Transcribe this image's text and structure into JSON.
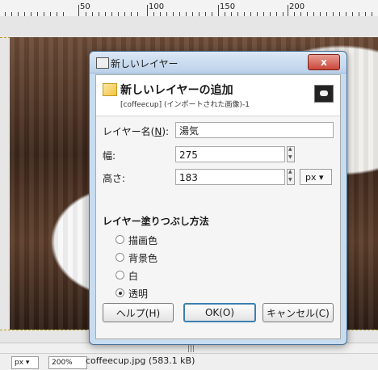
{
  "ruler": {
    "labels": [
      "50",
      "100",
      "150",
      "200"
    ]
  },
  "dialog": {
    "window_title": "新しいレイヤー",
    "close_label": "x",
    "header_title": "新しいレイヤーの追加",
    "header_subtitle": "[coffeecup] (インポートされた画像)-1",
    "layer_name_label_prefix": "レイヤー名(",
    "layer_name_label_mnemonic": "N",
    "layer_name_label_suffix": "):",
    "layer_name_value": "湯気",
    "width_label": "幅:",
    "width_value": "275",
    "height_label": "高さ:",
    "height_value": "183",
    "unit_value": "px ▾",
    "fill_section_label": "レイヤー塗りつぶし方法",
    "fill_options": [
      {
        "label": "描画色",
        "selected": false
      },
      {
        "label": "背景色",
        "selected": false
      },
      {
        "label": "白",
        "selected": false
      },
      {
        "label": "透明",
        "selected": true
      }
    ],
    "buttons": {
      "help": "ヘルプ(H)",
      "ok": "OK(O)",
      "cancel": "キャンセル(C)"
    }
  },
  "status": {
    "unit": "px ▾",
    "zoom": "200%",
    "file": "coffeecup.jpg (583.1 kB)"
  },
  "icons": {
    "title": "layer-icon",
    "header": "new-layer-icon",
    "thumb": "image-thumbnail-icon"
  }
}
